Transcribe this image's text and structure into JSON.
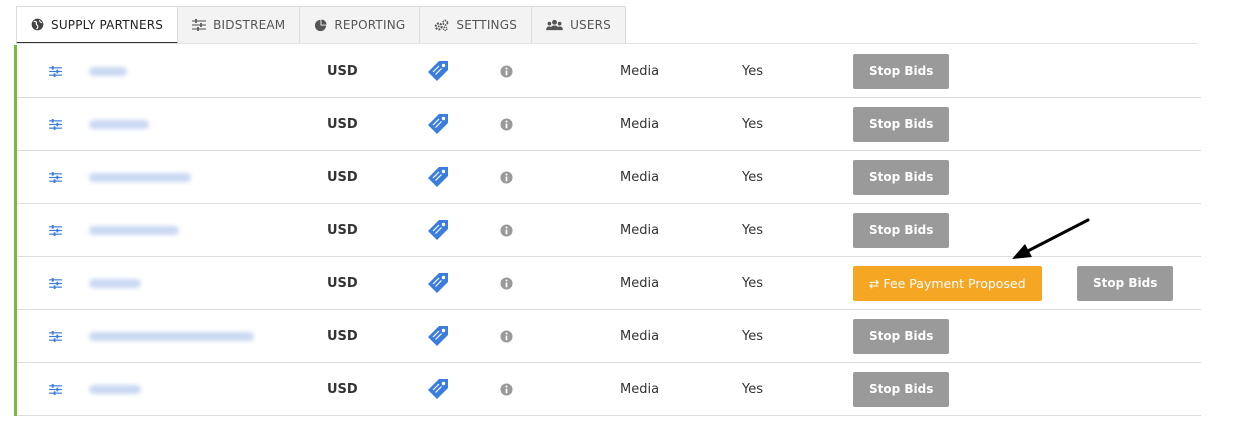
{
  "tabs": [
    {
      "label": "SUPPLY PARTNERS",
      "icon": "globe-icon",
      "active": true
    },
    {
      "label": "BIDSTREAM",
      "icon": "sliders-icon",
      "active": false
    },
    {
      "label": "REPORTING",
      "icon": "pie-chart-icon",
      "active": false
    },
    {
      "label": "SETTINGS",
      "icon": "gears-icon",
      "active": false
    },
    {
      "label": "USERS",
      "icon": "users-icon",
      "active": false
    }
  ],
  "rows": [
    {
      "currency": "USD",
      "type": "Media",
      "enabled": "Yes",
      "action": "Stop Bids",
      "fee_action": null
    },
    {
      "currency": "USD",
      "type": "Media",
      "enabled": "Yes",
      "action": "Stop Bids",
      "fee_action": null
    },
    {
      "currency": "USD",
      "type": "Media",
      "enabled": "Yes",
      "action": "Stop Bids",
      "fee_action": null
    },
    {
      "currency": "USD",
      "type": "Media",
      "enabled": "Yes",
      "action": "Stop Bids",
      "fee_action": null
    },
    {
      "currency": "USD",
      "type": "Media",
      "enabled": "Yes",
      "action": "Stop Bids",
      "fee_action": "⇄ Fee Payment Proposed"
    },
    {
      "currency": "USD",
      "type": "Media",
      "enabled": "Yes",
      "action": "Stop Bids",
      "fee_action": null
    },
    {
      "currency": "USD",
      "type": "Media",
      "enabled": "Yes",
      "action": "Stop Bids",
      "fee_action": null
    }
  ],
  "colors": {
    "accent_border": "#7cba3a",
    "fee_button": "#f5a623",
    "stop_button": "#9a9a9a",
    "link_icon": "#3b7ddd"
  }
}
